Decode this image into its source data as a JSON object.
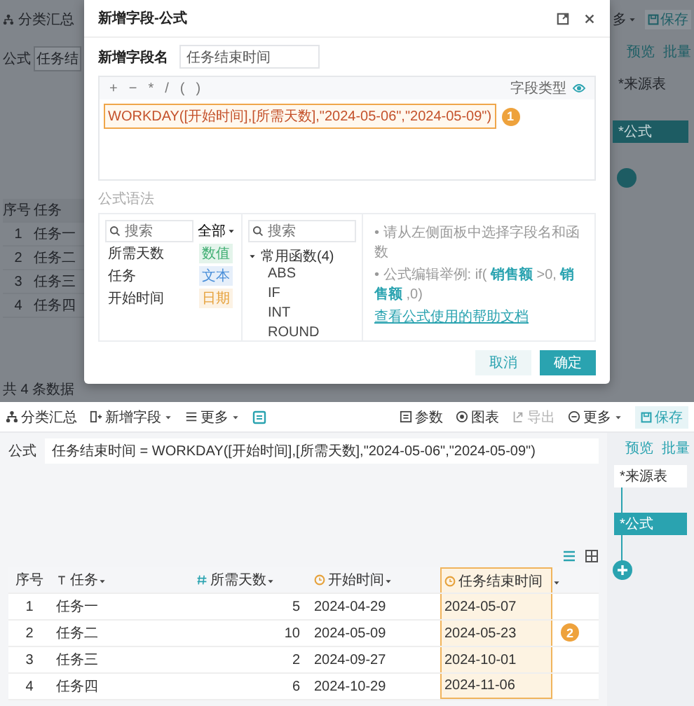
{
  "background": {
    "left": {
      "toolbar_item": "分类汇总",
      "formula_label": "公式",
      "formula_value": "任务结",
      "table": {
        "columns": [
          "序号",
          "任务"
        ],
        "rows": [
          [
            "1",
            "任务一"
          ],
          [
            "2",
            "任务二"
          ],
          [
            "3",
            "任务三"
          ],
          [
            "4",
            "任务四"
          ]
        ]
      },
      "footer": "共 4 条数据"
    },
    "right": {
      "more": "多",
      "save": "保存",
      "actions": [
        "预览",
        "批量"
      ],
      "nodes": [
        {
          "label": "*来源表",
          "selected": false
        },
        {
          "label": "*公式",
          "selected": true
        }
      ]
    }
  },
  "dialog": {
    "title": "新增字段-公式",
    "name_label": "新增字段名",
    "name_value": "任务结束时间",
    "operators": [
      "+",
      "−",
      "*",
      "/",
      "(",
      ")"
    ],
    "field_type_label": "字段类型",
    "formula": "WORKDAY([开始时间],[所需天数],\"2024-05-06\",\"2024-05-09\")",
    "formula_badge": "1",
    "section_title": "公式语法",
    "field_search": {
      "placeholder": "搜索"
    },
    "filter": "全部",
    "fields": [
      {
        "name": "所需天数",
        "tag": "数值",
        "color": "#3fae72"
      },
      {
        "name": "任务",
        "tag": "文本",
        "color": "#4a8fd9"
      },
      {
        "name": "开始时间",
        "tag": "日期",
        "color": "#e6a23c"
      }
    ],
    "function_search": {
      "placeholder": "搜索"
    },
    "function_groups": [
      {
        "label": "常用函数(4)",
        "expanded": true,
        "children": [
          {
            "label": "ABS"
          },
          {
            "label": "IF"
          },
          {
            "label": "INT"
          },
          {
            "label": "ROUND"
          }
        ]
      }
    ],
    "hints": [
      "• 请从左侧面板中选择字段名和函数",
      "• 公式编辑举例: if( **销售额** >0, **销售额** ,0)"
    ],
    "help_link": "查看公式使用的帮助文档",
    "buttons": [
      {
        "label": "取消",
        "kind": "secondary"
      },
      {
        "label": "确定",
        "kind": "primary"
      }
    ]
  },
  "app": {
    "toolbar_left": [
      {
        "kind": "summary",
        "label": "分类汇总",
        "dropdown": false
      },
      {
        "kind": "addfield",
        "label": "新增字段",
        "dropdown": true
      },
      {
        "kind": "list",
        "label": "更多",
        "dropdown": true
      }
    ],
    "toolbar_right": [
      {
        "kind": "params",
        "label": "参数",
        "dropdown": false,
        "disabled": false
      },
      {
        "kind": "chart",
        "label": "图表",
        "dropdown": false,
        "disabled": false
      },
      {
        "kind": "export",
        "label": "导出",
        "dropdown": false,
        "disabled": true
      },
      {
        "kind": "more",
        "label": "更多",
        "dropdown": true,
        "disabled": false
      }
    ],
    "save": "保存",
    "formula_label": "公式",
    "formula_value": "任务结束时间 = WORKDAY([开始时间],[所需天数],\"2024-05-06\",\"2024-05-09\")",
    "flow": {
      "actions": [
        "预览",
        "批量"
      ],
      "nodes": [
        {
          "label": "*来源表",
          "selected": false
        },
        {
          "label": "*公式",
          "selected": true
        }
      ]
    },
    "table": {
      "columns": [
        {
          "label": "序号",
          "kind": "index",
          "highlighted": false
        },
        {
          "label": "任务",
          "kind": "text",
          "highlighted": false
        },
        {
          "label": "所需天数",
          "kind": "number",
          "highlighted": false
        },
        {
          "label": "开始时间",
          "kind": "date",
          "highlighted": false
        },
        {
          "label": "任务结束时间",
          "kind": "date",
          "highlighted": true
        }
      ],
      "rows": [
        [
          "1",
          "任务一",
          "5",
          "2024-04-29",
          "2024-05-07"
        ],
        [
          "2",
          "任务二",
          "10",
          "2024-05-09",
          "2024-05-23"
        ],
        [
          "3",
          "任务三",
          "2",
          "2024-09-27",
          "2024-10-01"
        ],
        [
          "4",
          "任务四",
          "6",
          "2024-10-29",
          "2024-11-06"
        ]
      ],
      "badge": "2"
    }
  }
}
